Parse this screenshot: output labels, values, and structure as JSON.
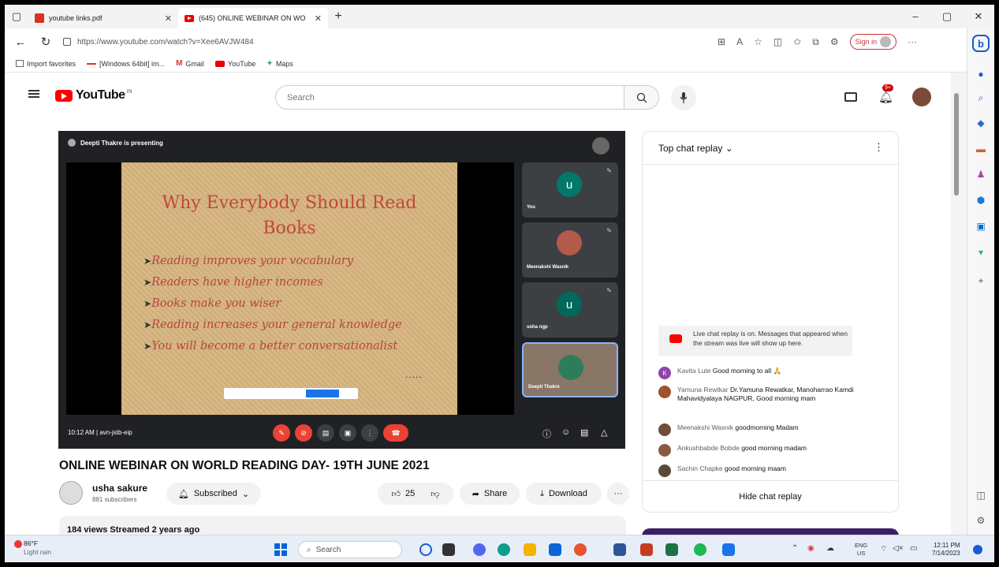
{
  "browser": {
    "tabs": [
      {
        "title": "youtube links.pdf"
      },
      {
        "title": "(645) ONLINE WEBINAR ON WO"
      }
    ],
    "url": "https://www.youtube.com/watch?v=Xee6AVJW484",
    "sign_in": "Sign in",
    "favorites": [
      {
        "label": "Import favorites"
      },
      {
        "label": "[Windows 64bit] im..."
      },
      {
        "label": "Gmail"
      },
      {
        "label": "YouTube"
      },
      {
        "label": "Maps"
      }
    ]
  },
  "youtube": {
    "logo": "YouTube",
    "region": "IN",
    "search_placeholder": "Search",
    "notifications": "9+",
    "player": {
      "presenter": "Deepti Thakre is presenting",
      "slide_title_1": "Why Everybody Should Read",
      "slide_title_2": "Books",
      "slide_points": [
        "Reading improves your vocabulary",
        "Readers have higher incomes",
        "Books make you wiser",
        "Reading increases your general knowledge",
        "You will become a better conversationalist"
      ],
      "slide_dots": ".....",
      "participants": [
        {
          "initial": "u",
          "name": "You"
        },
        {
          "initial": "",
          "name": "Meenakshi Wasnik"
        },
        {
          "initial": "u",
          "name": "usha ngp"
        },
        {
          "initial": "",
          "name": "Deepti Thakre"
        }
      ],
      "meeting_time": "10:12 AM  |  avn-jstb-eip"
    },
    "video_title": "ONLINE WEBINAR ON WORLD READING DAY- 19TH JUNE 2021",
    "channel": {
      "name": "usha sakure",
      "subscribers": "881 subscribers"
    },
    "subscribed_label": "Subscribed",
    "likes": "25",
    "share_label": "Share",
    "download_label": "Download",
    "description": "184 views  Streamed 2 years ago",
    "chat": {
      "header": "Top chat replay",
      "notice": "Live chat replay is on. Messages that appeared when the stream was live will show up here.",
      "messages": [
        {
          "author": "Kavita Lute",
          "text": "Good morning to all 🙏",
          "initial": "K",
          "color": "#8e44ad"
        },
        {
          "author": "Yamuna Rewtkar",
          "text": "Dr.Yamuna Rewatkar, Manoharrao Kamdi Mahavidyalaya NAGPUR, Good morning mam",
          "initial": "",
          "color": "#a0522d"
        },
        {
          "author": "Meenakshi Wasnik",
          "text": "goodmorning Madam",
          "initial": "",
          "color": "#6b4f3a"
        },
        {
          "author": "Ankushbabde Bobde",
          "text": "good morning madam",
          "initial": "",
          "color": "#8b5a40"
        },
        {
          "author": "Sachin Chapke",
          "text": "good morning maam",
          "initial": "",
          "color": "#5a4a3a"
        }
      ],
      "hide": "Hide chat replay"
    }
  },
  "taskbar": {
    "weather_temp": "86°F",
    "weather_desc": "Light rain",
    "search": "Search",
    "lang_1": "ENG",
    "lang_2": "US",
    "time": "12:11 PM",
    "date": "7/14/2023"
  }
}
